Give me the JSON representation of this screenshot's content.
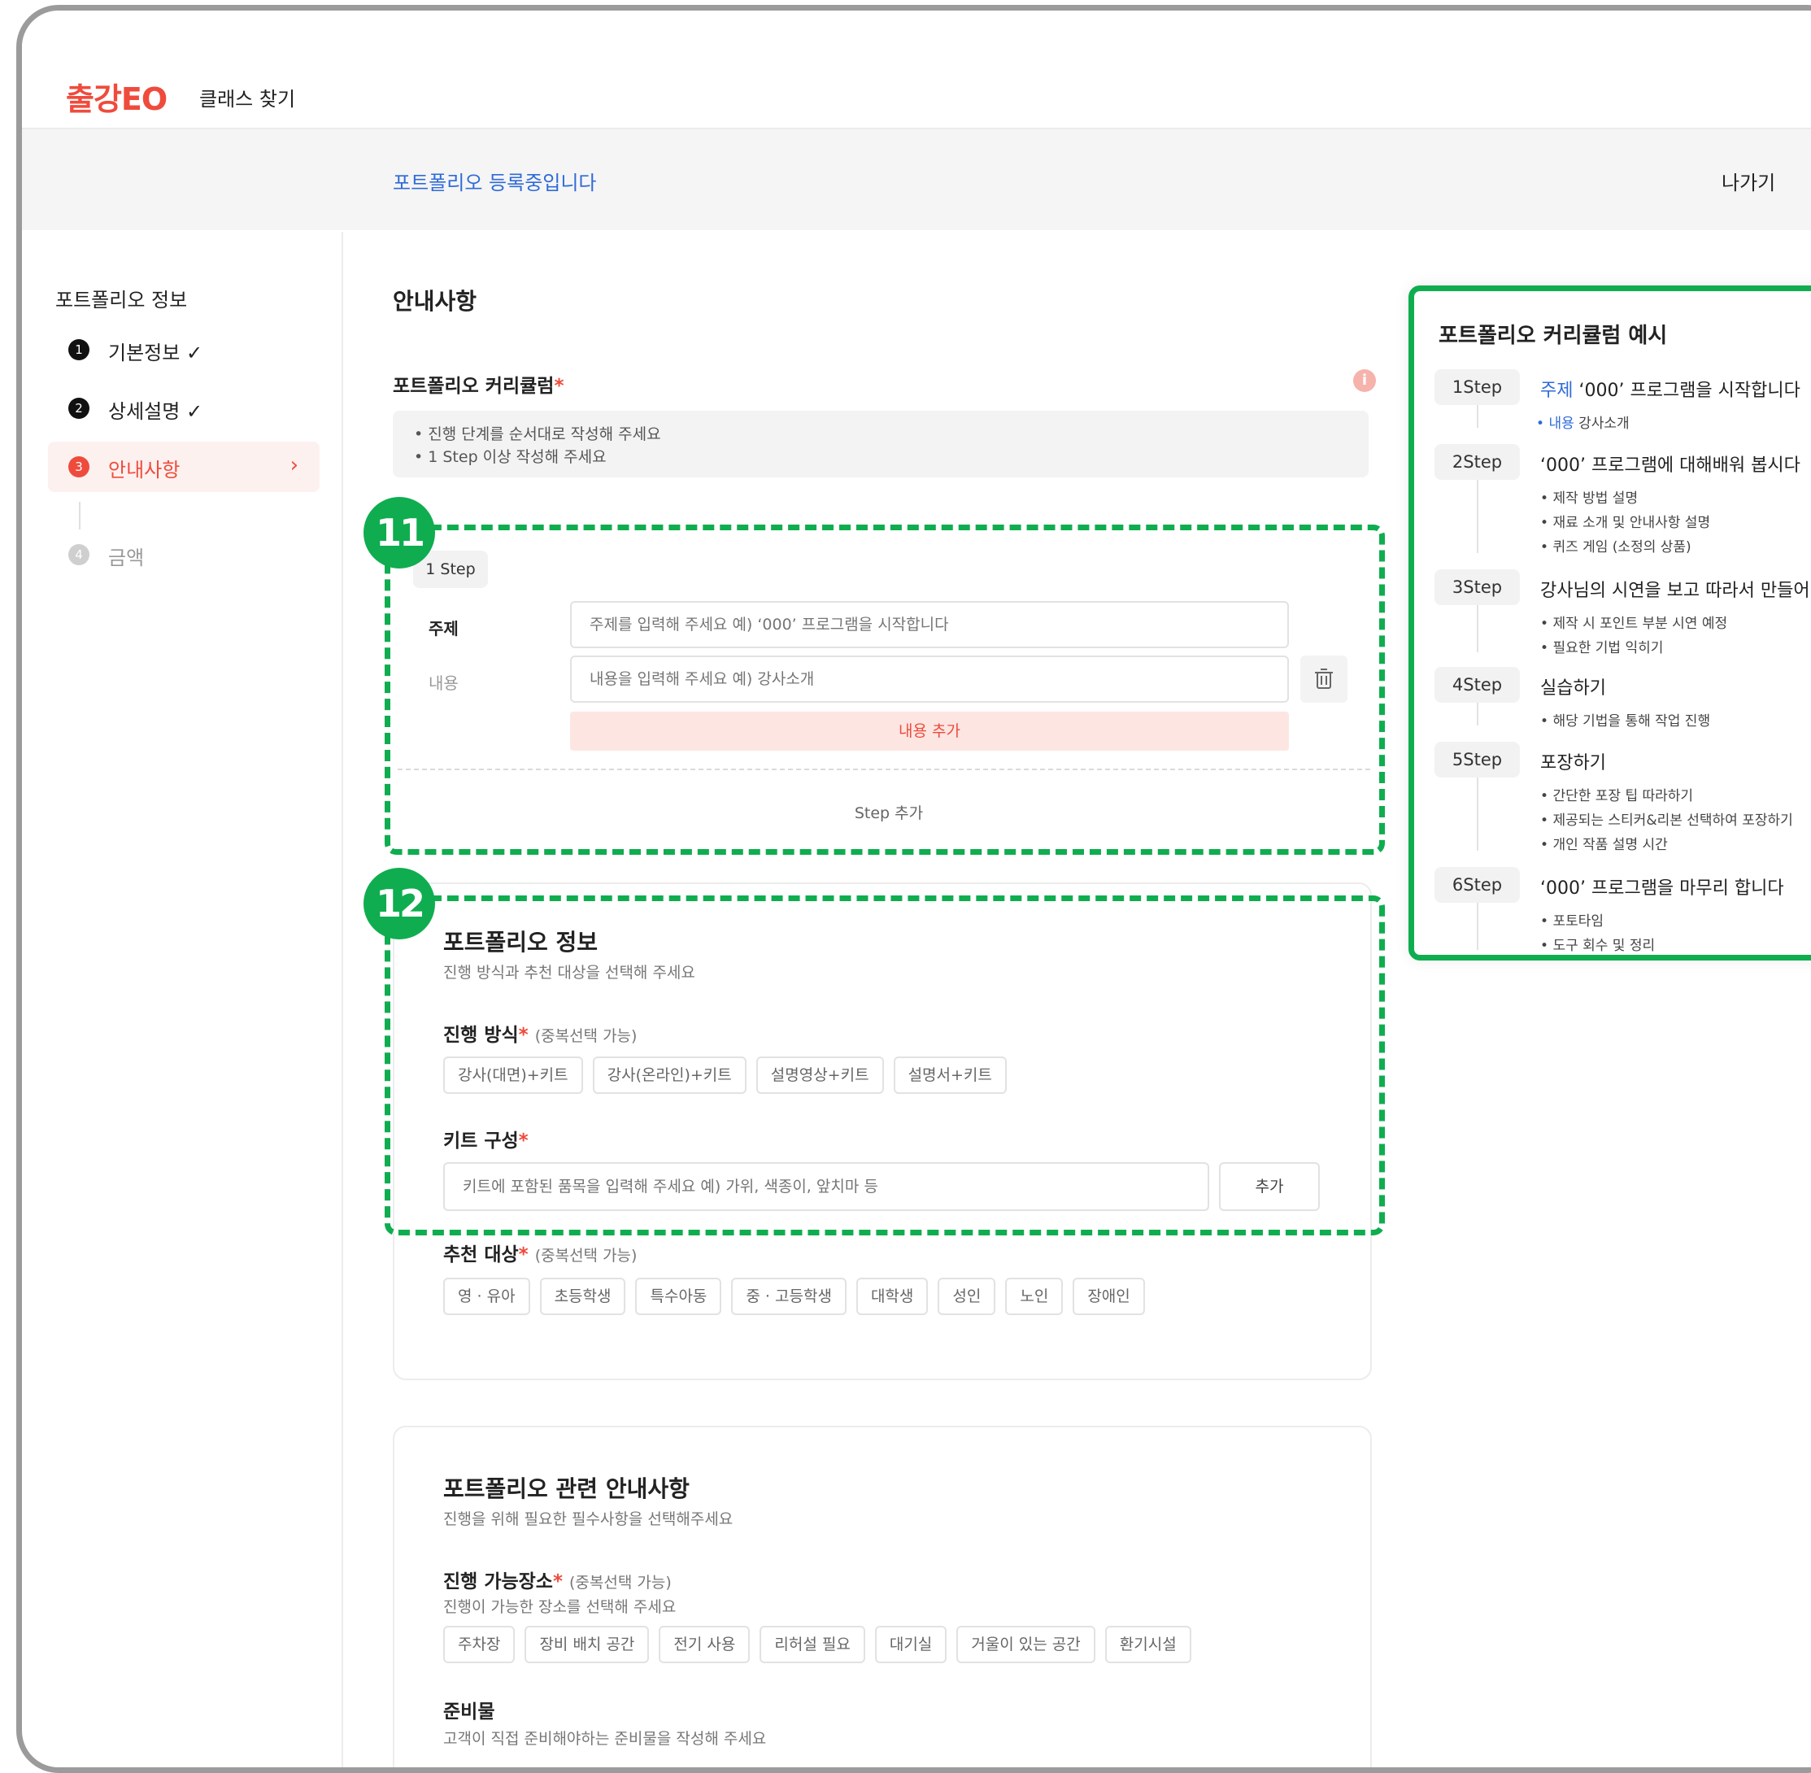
{
  "header": {
    "logo": "출강EO",
    "nav_find": "클래스 찾기"
  },
  "reg_bar": {
    "status": "포트폴리오 등록중입니다",
    "exit": "나가기"
  },
  "sidebar": {
    "title": "포트폴리오 정보",
    "items": [
      {
        "num": "1",
        "label": "기본정보 ✓"
      },
      {
        "num": "2",
        "label": "상세설명 ✓"
      },
      {
        "num": "3",
        "label": "안내사항",
        "chevron": "›"
      },
      {
        "num": "4",
        "label": "금액"
      }
    ]
  },
  "main": {
    "title": "안내사항",
    "curriculum_label": "포트폴리오 커리큘럼",
    "required_mark": "*",
    "info_icon": "i",
    "guide": [
      "• 진행 단계를 순서대로 작성해 주세요",
      "• 1 Step 이상 작성해 주세요"
    ],
    "step": {
      "chip": "1 Step",
      "subject_label": "주제",
      "subject_placeholder": "주제를 입력해 주세요 예) ‘000’ 프로그램을 시작합니다",
      "content_label": "내용",
      "content_placeholder": "내용을 입력해 주세요 예) 강사소개",
      "add_content": "내용 추가",
      "add_step": "Step 추가"
    },
    "badges": {
      "b11": "11",
      "b12": "12"
    },
    "info_card": {
      "title": "포트폴리오 정보",
      "subtitle": "진행 방식과 추천 대상을 선택해 주세요",
      "method_label": "진행 방식",
      "method_opt": "(중복선택 가능)",
      "methods": [
        "강사(대면)+키트",
        "강사(온라인)+키트",
        "설명영상+키트",
        "설명서+키트"
      ],
      "kit_label": "키트 구성",
      "kit_placeholder": "키트에 포함된 품목을 입력해 주세요 예) 가위, 색종이, 앞치마 등",
      "kit_add": "추가",
      "target_label": "추천 대상",
      "target_opt": "(중복선택 가능)",
      "targets": [
        "영 · 유아",
        "초등학생",
        "특수아동",
        "중 · 고등학생",
        "대학생",
        "성인",
        "노인",
        "장애인"
      ]
    },
    "notice_card": {
      "title": "포트폴리오 관련 안내사항",
      "subtitle": "진행을 위해 필요한 필수사항을 선택해주세요",
      "place_label": "진행 가능장소",
      "place_opt": "(중복선택 가능)",
      "place_sub": "진행이 가능한 장소를 선택해 주세요",
      "places": [
        "주차장",
        "장비 배치 공간",
        "전기 사용",
        "리허설 필요",
        "대기실",
        "거울이 있는 공간",
        "환기시설"
      ],
      "prep_label": "준비물",
      "prep_sub": "고객이 직접 준비해야하는 준비물을 작성해 주세요"
    }
  },
  "example": {
    "title": "포트폴리오 커리큘럼 예시",
    "steps": [
      {
        "step": "1Step",
        "head_prefix": "주제",
        "head": " ‘000’ 프로그램을 시작합니다",
        "bullet_prefix": "내용",
        "bullets": [
          "강사소개"
        ]
      },
      {
        "step": "2Step",
        "head": "‘000’ 프로그램에 대해배워 봅시다",
        "bullets": [
          "제작 방법 설명",
          "재료 소개 및 안내사항 설명",
          "퀴즈 게임 (소정의 상품)"
        ]
      },
      {
        "step": "3Step",
        "head": "강사님의 시연을 보고 따라서 만들어 봅시다",
        "bullets": [
          "제작 시 포인트 부분 시연 예정",
          "필요한 기법 익히기"
        ]
      },
      {
        "step": "4Step",
        "head": "실습하기",
        "bullets": [
          "해당 기법을 통해 작업 진행"
        ]
      },
      {
        "step": "5Step",
        "head": "포장하기",
        "bullets": [
          "간단한 포장 팁 따라하기",
          "제공되는 스티커&리본 선택하여 포장하기",
          "개인 작품 설명 시간"
        ]
      },
      {
        "step": "6Step",
        "head": "‘000’ 프로그램을 마무리 합니다",
        "bullets": [
          "포토타임",
          "도구 회수 및 정리"
        ]
      }
    ]
  },
  "colors": {
    "accent": "#ef4b3c",
    "link": "#2f6bd8",
    "highlight": "#0fad4f"
  }
}
